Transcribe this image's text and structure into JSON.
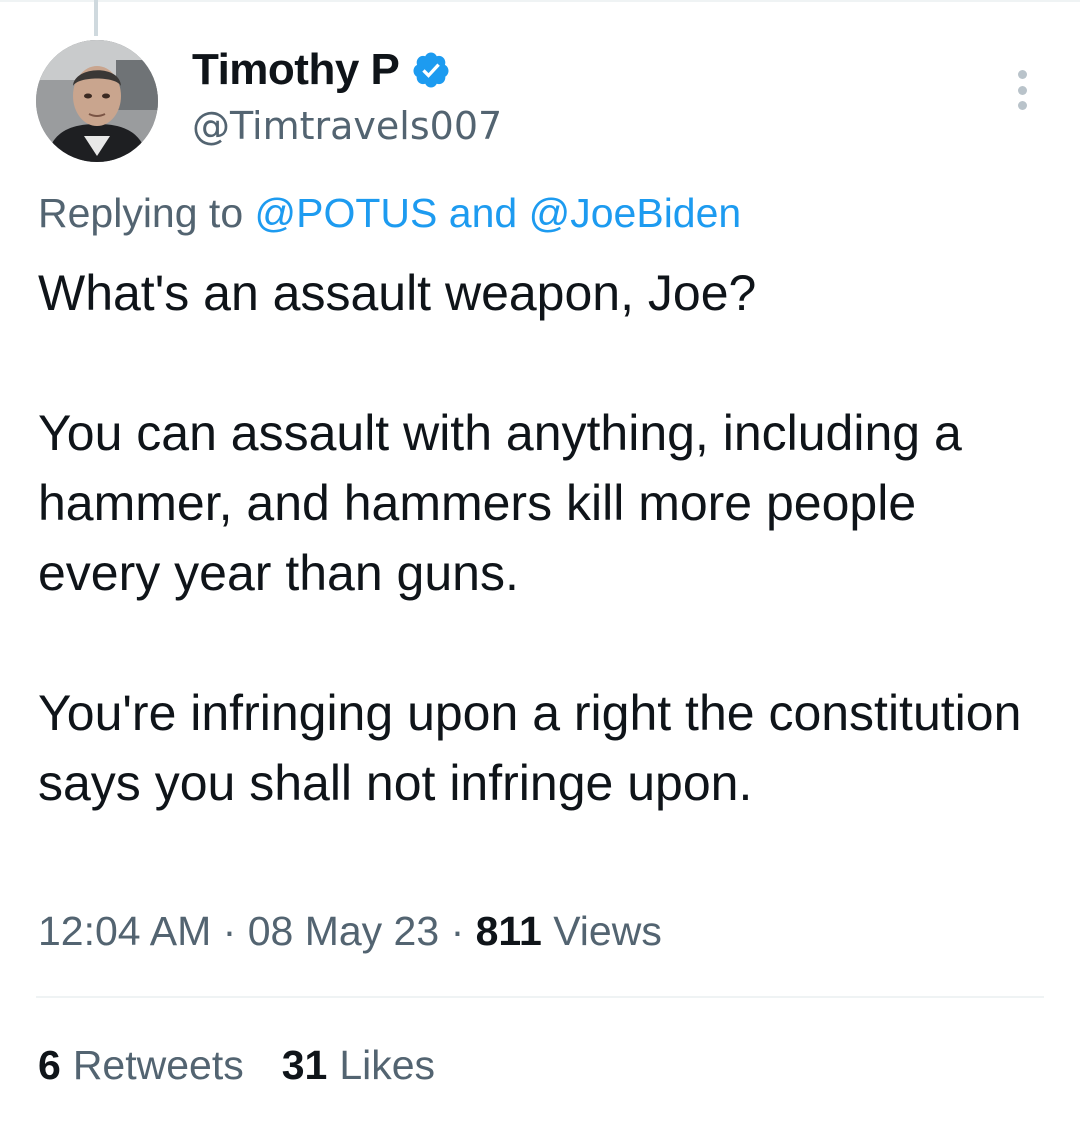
{
  "author": {
    "display_name": "Timothy P",
    "handle": "@Timtravels007",
    "verified_icon": "verified-badge-icon",
    "badge_color": "#1d9bf0"
  },
  "reply": {
    "prefix": "Replying to",
    "mention_1": "@POTUS",
    "joiner": "and",
    "mention_2": "@JoeBiden"
  },
  "tweet": {
    "paragraphs": [
      "What's an assault weapon, Joe?",
      "You can assault with anything, including a hammer, and hammers kill more people every year than guns.",
      "You're infringing upon a right the constitution says you shall not infringe upon."
    ]
  },
  "meta": {
    "time": "12:04 AM",
    "separator": "·",
    "date": "08 May 23",
    "views_count": "811",
    "views_label": "Views"
  },
  "stats": {
    "retweets_count": "6",
    "retweets_label": "Retweets",
    "likes_count": "31",
    "likes_label": "Likes"
  },
  "colors": {
    "accent": "#1d9bf0",
    "text_primary": "#0f1419",
    "text_secondary": "#536471"
  }
}
